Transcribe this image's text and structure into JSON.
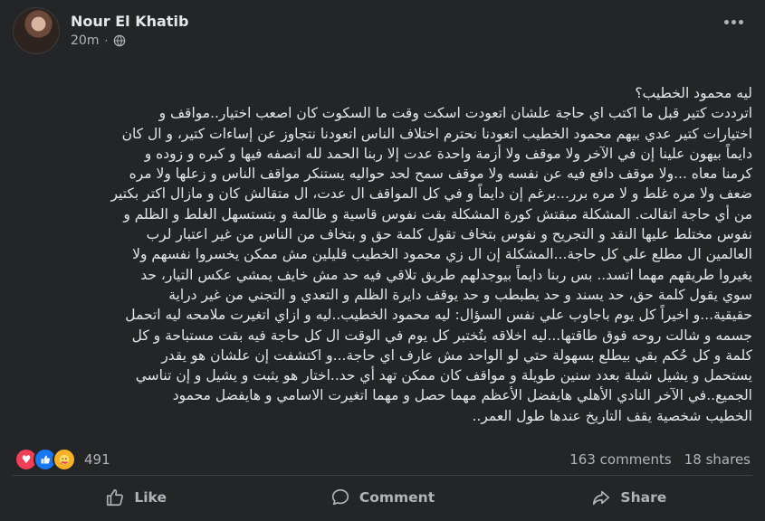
{
  "post": {
    "author": "Nour El Khatib",
    "time": "20m",
    "separator": "·",
    "privacy_icon": "globe-icon",
    "lines": [
      "ليه محمود الخطيب؟",
      "اترددت كتير قبل ما اكتب اي حاجة علشان اتعودت اسكت وقت ما السكوت كان اصعب اختيار..مواقف و",
      "اختيارات كتير عدي بيهم محمود الخطيب اتعودنا نحترم اختلاف الناس اتعودنا نتجاوز عن إساءات كتير، و ال كان",
      "دايماً بيهون علينا إن في الآخر ولا موقف ولا أزمة واحدة عدت إلا ربنا الحمد لله انصفه فيها و كبره و زوده و",
      "كرمنا معاه ...ولا موقف دافع فيه عن نفسه ولا موقف سمح لحد حواليه يستنكر مواقف الناس و زعلها ولا مره",
      "ضعف ولا مره غلط و لا مره برر...برغم إن دايماً و في كل المواقف ال عدت، ال متقالش كان و مازال اكتر بكتير",
      "من أي حاجة اتقالت. المشكلة مبقتش كورة المشكلة بقت نفوس قاسية و ظالمة و بتستسهل الغلط و الظلم و",
      "نفوس مختلط عليها النقد و التجريح و نفوس بتخاف تقول كلمة حق و بتخاف من الناس من غير اعتبار لرب",
      "العالمين ال مطلع علي كل حاجة...المشكلة إن ال زي محمود الخطيب قليلين مش ممكن يخسروا نفسهم ولا",
      "يغيروا طريقهم مهما اتسد.. بس ربنا دايماً بيوجدلهم طريق تلاقي فيه حد مش خايف يمشي عكس التيار، حد",
      "سوي يقول كلمة حق، حد يسند و حد يطبطب و حد يوقف دايرة الظلم و التعدي و التجني من غير دراية",
      "حقيقية...و اخيراً كل يوم باجاوب علي نفس السؤال: ليه محمود الخطيب..ليه و ازاي اتغيرت ملامحه ليه اتحمل",
      "جسمه و شالت روحه فوق طاقتها...ليه اخلاقه بتُختبر كل يوم في الوقت ال كل حاجة فيه بقت مستباحة و كل",
      "كلمة و كل حُكم بقي بيطلع بسهولة حتي لو الواحد مش عارف اي حاجة...و اكتشفت إن علشان هو يقدر",
      "يستحمل و يشيل شيلة بعدد سنين طويلة و مواقف كان ممكن تهد أي حد..اختار هو يثبت و يشيل و إن تناسي",
      "الجميع..في الآخر النادي الأهلي هايفضل الأعظم مهما حصل و مهما اتغيرت الاسامي و هايفضل محمود",
      "الخطيب شخصية يقف التاريخ عندها طول العمر.."
    ]
  },
  "stats": {
    "reaction_count": "491",
    "comments": "163 comments",
    "shares": "18 shares"
  },
  "actions": {
    "like": "Like",
    "comment": "Comment",
    "share": "Share"
  },
  "colors": {
    "background": "#242526",
    "text": "#e4e6eb",
    "secondary": "#b0b3b8",
    "like_blue": "#1877f2",
    "love_red": "#f33e58",
    "care_yellow": "#f7b125"
  }
}
